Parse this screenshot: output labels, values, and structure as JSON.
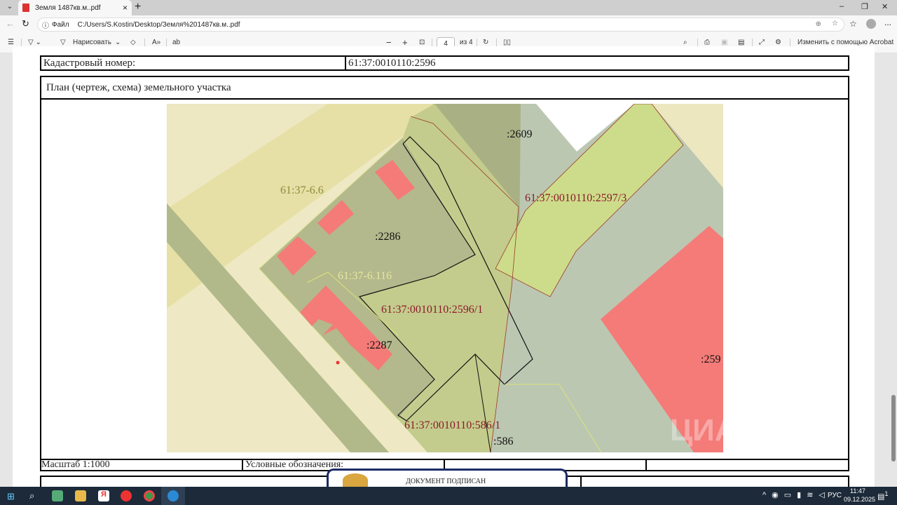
{
  "browser": {
    "tab_title": "Земля 1487кв.м..pdf",
    "new_tab": "+",
    "window_controls": [
      "–",
      "❐",
      "✕"
    ],
    "address_prefix": "Файл",
    "url": "C:/Users/S.Kostin/Desktop/Земля%201487кв.м..pdf",
    "more": "..."
  },
  "pdf_toolbar": {
    "draw_label": "Нарисовать",
    "page_current": "4",
    "page_total": "из 4",
    "zoom_out": "−",
    "zoom_in": "+",
    "edit_acrobat": "Изменить с помощью Acrobat"
  },
  "document": {
    "cadastral_label": "Кадастровый номер:",
    "cadastral_value": "61:37:0010110:2596",
    "plan_title": "План (чертеж, схема) земельного участка",
    "scale": "Масштаб 1:1000",
    "legend_label": "Условные обозначения:",
    "stamp_text": "ДОКУМЕНТ ПОДПИСАН",
    "watermark": "ЦИАН",
    "map_labels": {
      "p2609": ":2609",
      "zone66": "61:37-6.6",
      "p2286": ":2286",
      "p25973": "61:37:0010110:2597/3",
      "zone6116": "61:37-6.116",
      "p25961": "61:37:0010110:2596/1",
      "p2287": ":2287",
      "p259x": ":259",
      "p5861": "61:37:0010110:586/1",
      "p586": ":586"
    },
    "colors": {
      "red_label": "#8b1a2b",
      "building": "#f47b78"
    }
  },
  "taskbar": {
    "lang": "РУС",
    "time": "11:47",
    "date": "09.12.2025",
    "notifications": "1"
  }
}
